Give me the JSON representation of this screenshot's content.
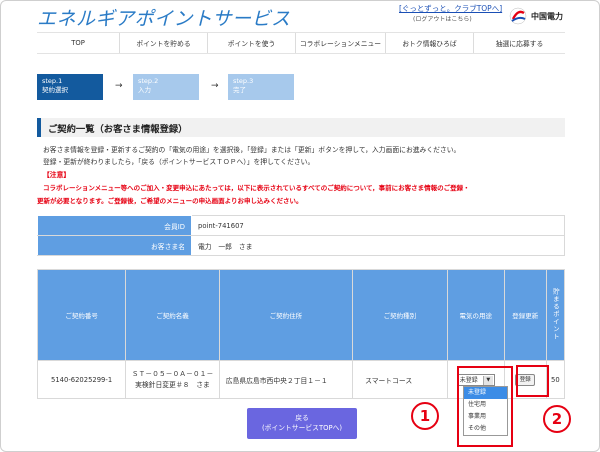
{
  "header": {
    "title": "エネルギアポイントサービス",
    "club_link": "[ぐっとずっと。クラブTOPへ]",
    "login_status": "(ログアウトはこちら)",
    "company": "中国電力"
  },
  "nav": [
    "TOP",
    "ポイントを貯める",
    "ポイントを使う",
    "コラボレーションメニュー",
    "おトク情報ひろば",
    "抽選に応募する"
  ],
  "steps": [
    {
      "num": "step.1",
      "label": "契約選択"
    },
    {
      "num": "step.2",
      "label": "入力"
    },
    {
      "num": "step.3",
      "label": "完了"
    }
  ],
  "section_title": "ご契約一覧（お客さま情報登録）",
  "instructions": [
    "お客さま情報を登録・更新するご契約の「電気の用途」を選択後，「登録」または「更新」ボタンを押して，入力画面にお進みください。",
    "登録・更新が終わりましたら，「戻る（ポイントサービスＴＯＰへ）」を押してください。"
  ],
  "notice_label": "【注意】",
  "notice_lines": [
    "コラボレーションメニュー等へのご加入・変更申込にあたっては，以下に表示されているすべてのご契約について，事前にお客さま情報のご登録・",
    "更新が必要となります。ご登録後，ご希望のメニューの申込画面よりお申し込みください。"
  ],
  "member": {
    "id_label": "会員ID",
    "id_value": "point-741607",
    "name_label": "お客さま名",
    "name_value": "電力　一郎　さま"
  },
  "contract_table": {
    "headers": [
      "ご契約番号",
      "ご契約名義",
      "ご契約住所",
      "ご契約種別",
      "電気の用途",
      "登録更新",
      "貯まるポイント"
    ],
    "row": {
      "number": "5140-62025299-1",
      "name_line1": "ＳＴ－０５－０Ａ－０１－",
      "name_line2": "実検針日変更＃８　さま",
      "address": "広島県広島市西中央２丁目１－１",
      "type": "スマートコース",
      "usage_selected": "未登録",
      "register_btn": "登録",
      "points": "50"
    }
  },
  "usage_options": [
    "未登録",
    "住宅用",
    "事業用",
    "その他"
  ],
  "back_button": {
    "line1": "戻る",
    "line2": "(ポイントサービスTOPへ)"
  },
  "callouts": [
    "1",
    "2"
  ],
  "colors": {
    "brand_blue": "#2a7bc6",
    "step_active": "#135a9e",
    "table_header": "#5f9ee2",
    "highlight_red": "#e60012",
    "back_button": "#6a66e0"
  }
}
